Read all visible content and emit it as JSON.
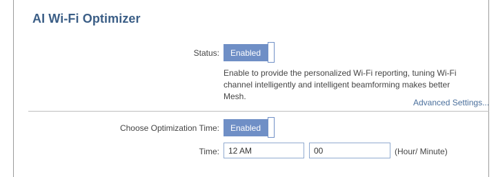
{
  "page": {
    "title": "AI Wi-Fi Optimizer"
  },
  "status": {
    "label": "Status:",
    "toggle_text": "Enabled",
    "description": "Enable to provide the personalized Wi-Fi reporting, tuning Wi-Fi channel intelligently and intelligent beamforming makes better Mesh."
  },
  "advanced_link": "Advanced Settings...",
  "optimization": {
    "label": "Choose Optimization Time:",
    "toggle_text": "Enabled"
  },
  "time": {
    "label": "Time:",
    "hour_value": "12 AM",
    "minute_value": "00",
    "unit": "(Hour/ Minute)"
  },
  "colors": {
    "title": "#3b5e86",
    "toggle_on": "#6f8fc6",
    "link": "#4a6f9c"
  }
}
